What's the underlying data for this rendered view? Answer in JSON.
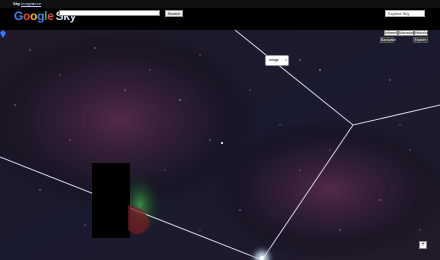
{
  "topbar": {
    "sky": "Sky",
    "web": "Images",
    "more": "more"
  },
  "header": {
    "logo_google": "Google",
    "logo_sky": "Sky",
    "search_value": "",
    "search_button": "Search",
    "layer_select": "Explore Sky"
  },
  "sky_view": {
    "bubble_label": "Image",
    "bubble_close": "x",
    "zoom_plus": "+",
    "infrared": "Infrared",
    "microwave": "Microwave",
    "historical": "Historical",
    "backyard": "Backyard",
    "explore": "Explore"
  },
  "colors": {
    "background": "#000000",
    "constellation_line": "#cfcfe6",
    "link_yellow": "#ffd34d",
    "link_blue": "#b9c8ff",
    "pin_blue": "#3b74ff"
  },
  "icons": {
    "pin": "map-pin-icon",
    "close": "close-icon",
    "zoom": "zoom-plus-icon"
  }
}
